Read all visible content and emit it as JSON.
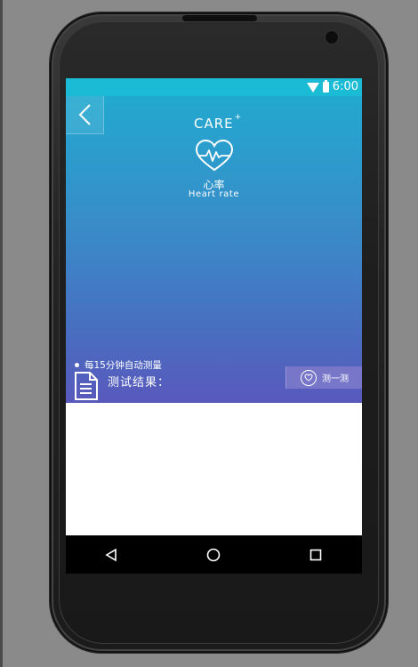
{
  "status_bar": {
    "time": "6:00"
  },
  "app": {
    "brand": "CARE",
    "brand_sup": "+",
    "title_cn": "心率",
    "title_en": "Heart rate",
    "auto_measure_note": "每15分钟自动测量",
    "result_label": "测试结果：",
    "measure_button_label": "测一测"
  },
  "icons": {
    "back": "chevron-left-icon",
    "heart": "heart-pulse-icon",
    "document": "document-icon",
    "measure": "heart-outline-icon",
    "wifi": "wifi-icon",
    "battery": "battery-icon",
    "nav_back": "triangle-back-icon",
    "nav_home": "circle-home-icon",
    "nav_recent": "square-recent-icon"
  },
  "colors": {
    "statusbar": "#1bbbd6",
    "gradient_top": "#22a9cf",
    "gradient_bottom": "#5959bc",
    "measure_button": "#7776c9"
  }
}
